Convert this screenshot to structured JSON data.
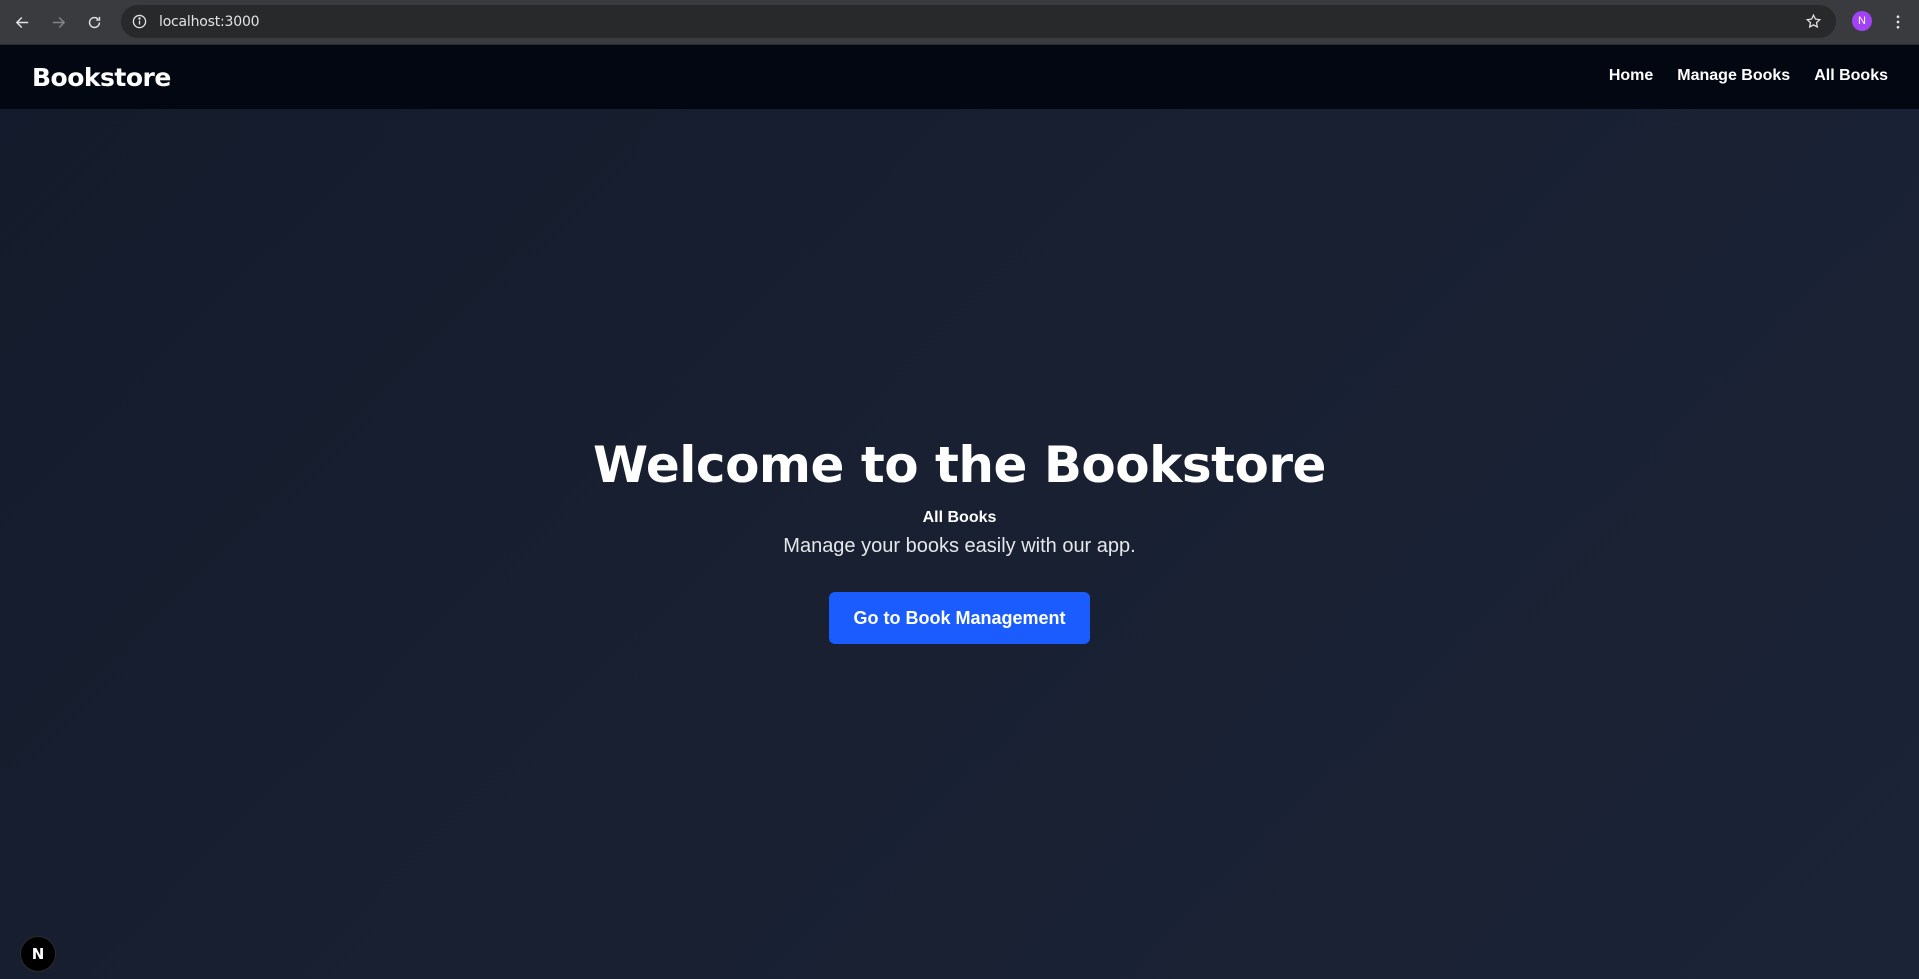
{
  "browser": {
    "url": "localhost:3000",
    "profile_initial": "N",
    "profile_color": "#a142f4"
  },
  "header": {
    "brand": "Bookstore",
    "nav": [
      {
        "label": "Home"
      },
      {
        "label": "Manage Books"
      },
      {
        "label": "All Books"
      }
    ]
  },
  "hero": {
    "title": "Welcome to the Bookstore",
    "subtitle": "All Books",
    "description": "Manage your books easily with our app.",
    "button_label": "Go to Book Management",
    "button_color": "#1a5cff"
  },
  "dev_badge": {
    "letter": "N"
  },
  "colors": {
    "header_bg": "#030712",
    "page_bg": "#1a2233"
  }
}
